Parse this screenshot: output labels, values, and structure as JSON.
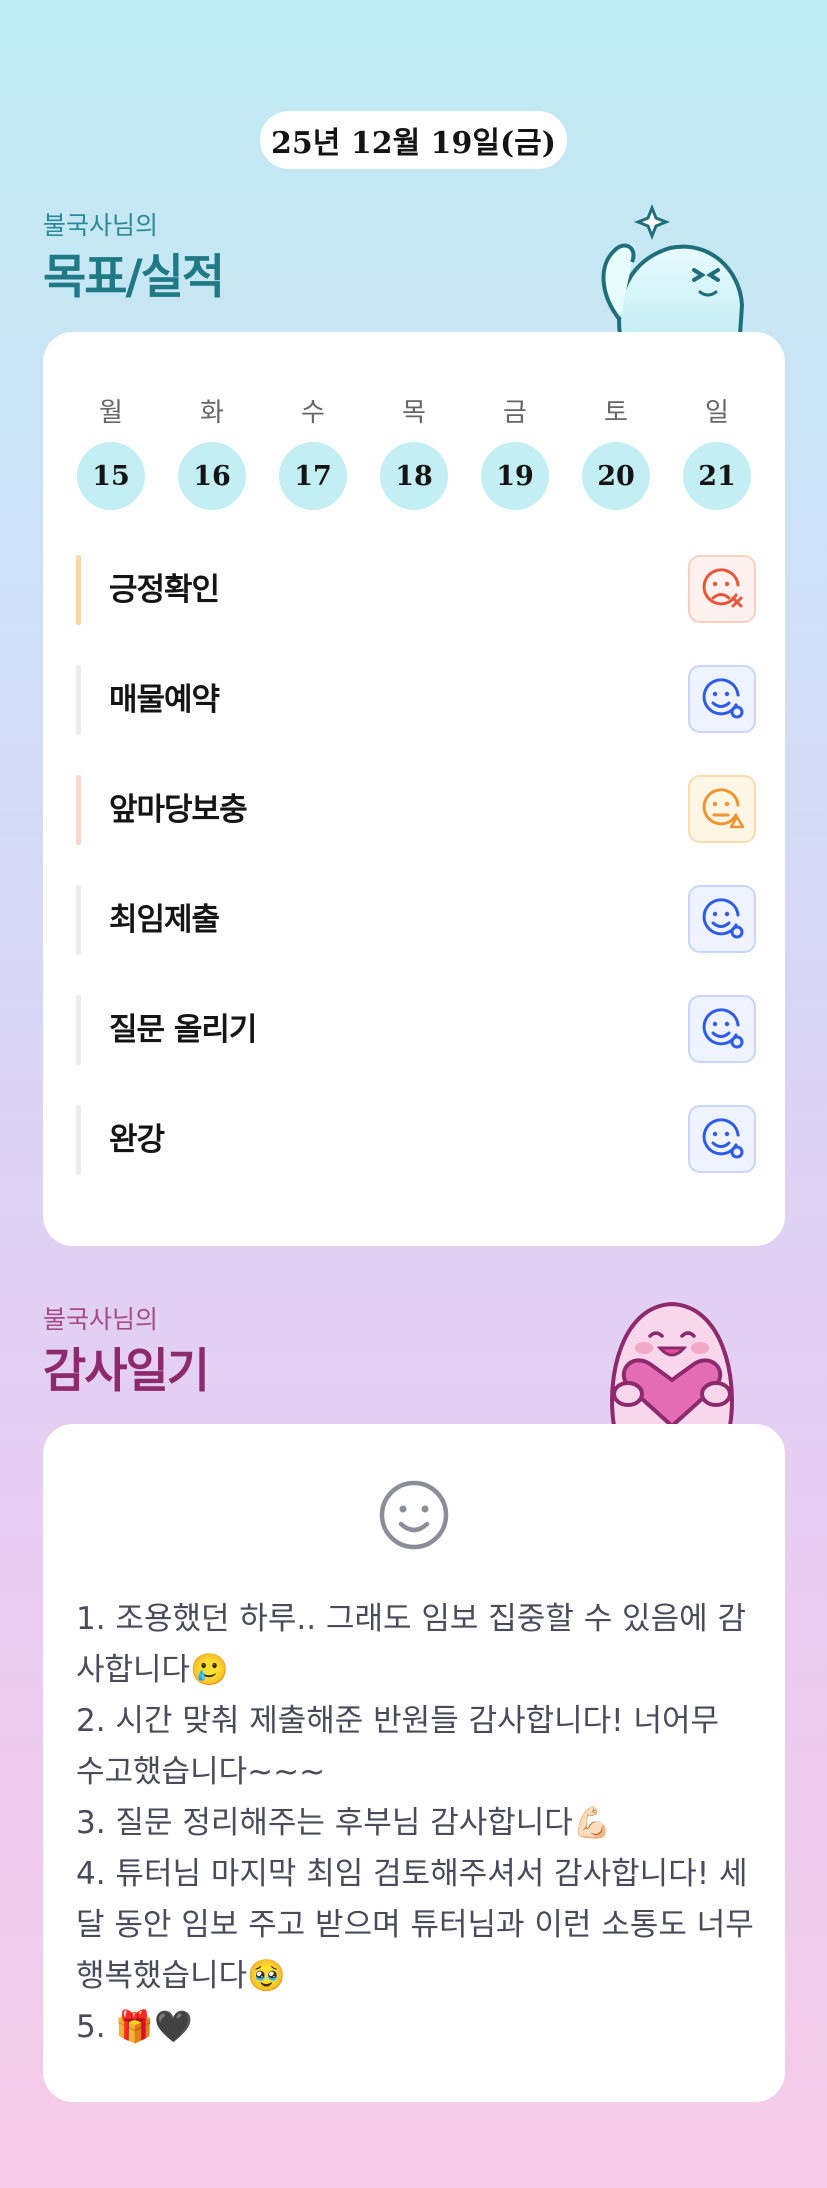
{
  "date": "25년 12월 19일(금)",
  "goals": {
    "subtitle": "불국사님의",
    "title": "목표/실적",
    "days": [
      {
        "name": "월",
        "num": "15"
      },
      {
        "name": "화",
        "num": "16"
      },
      {
        "name": "수",
        "num": "17"
      },
      {
        "name": "목",
        "num": "18"
      },
      {
        "name": "금",
        "num": "19"
      },
      {
        "name": "토",
        "num": "20"
      },
      {
        "name": "일",
        "num": "21"
      }
    ],
    "tasks": [
      {
        "label": "긍정확인",
        "bar_color": "#f8d8a8",
        "status_icon": "sad-x-face-icon",
        "status_color": "#e8553a"
      },
      {
        "label": "매물예약",
        "bar_color": "#ececf0",
        "status_icon": "smile-check-face-icon",
        "status_color": "#2e5be8"
      },
      {
        "label": "앞마당보충",
        "bar_color": "#f9d6cc",
        "status_icon": "meh-warning-face-icon",
        "status_color": "#ee9430"
      },
      {
        "label": "최임제출",
        "bar_color": "#ececf0",
        "status_icon": "smile-check-face-icon",
        "status_color": "#2e5be8"
      },
      {
        "label": "질문 올리기",
        "bar_color": "#ececf0",
        "status_icon": "smile-check-face-icon",
        "status_color": "#2e5be8"
      },
      {
        "label": "완강",
        "bar_color": "#ececf0",
        "status_icon": "smile-check-face-icon",
        "status_color": "#2e5be8"
      }
    ]
  },
  "gratitude": {
    "subtitle": "불국사님의",
    "title": "감사일기",
    "mood_icon": "smile-face-icon",
    "text": "1. 조용했던 하루.. 그래도 임보 집중할 수 있음에 감사합니다🥲\n2. 시간 맞춰 제출해준 반원들 감사합니다! 너어무 수고했습니다~~~\n3. 질문 정리해주는 후부님 감사합니다💪🏻\n4. 튜터님 마지막 최임 검토해주셔서 감사합니다! 세달 동안 임보 주고 받으며 튜터님과 이런 소통도 너무 행복했습니다🥹\n5. 🎁🖤"
  }
}
